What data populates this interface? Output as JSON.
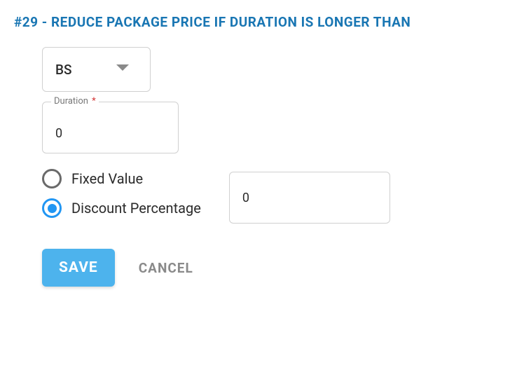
{
  "title": "#29 - REDUCE PACKAGE PRICE IF DURATION IS LONGER THAN",
  "select": {
    "value": "BS"
  },
  "duration": {
    "label": "Duration",
    "required_mark": "*",
    "value": "0"
  },
  "radios": {
    "fixed": "Fixed Value",
    "percentage": "Discount Percentage",
    "selected": "percentage"
  },
  "amount": {
    "value": "0"
  },
  "buttons": {
    "save": "SAVE",
    "cancel": "CANCEL"
  }
}
